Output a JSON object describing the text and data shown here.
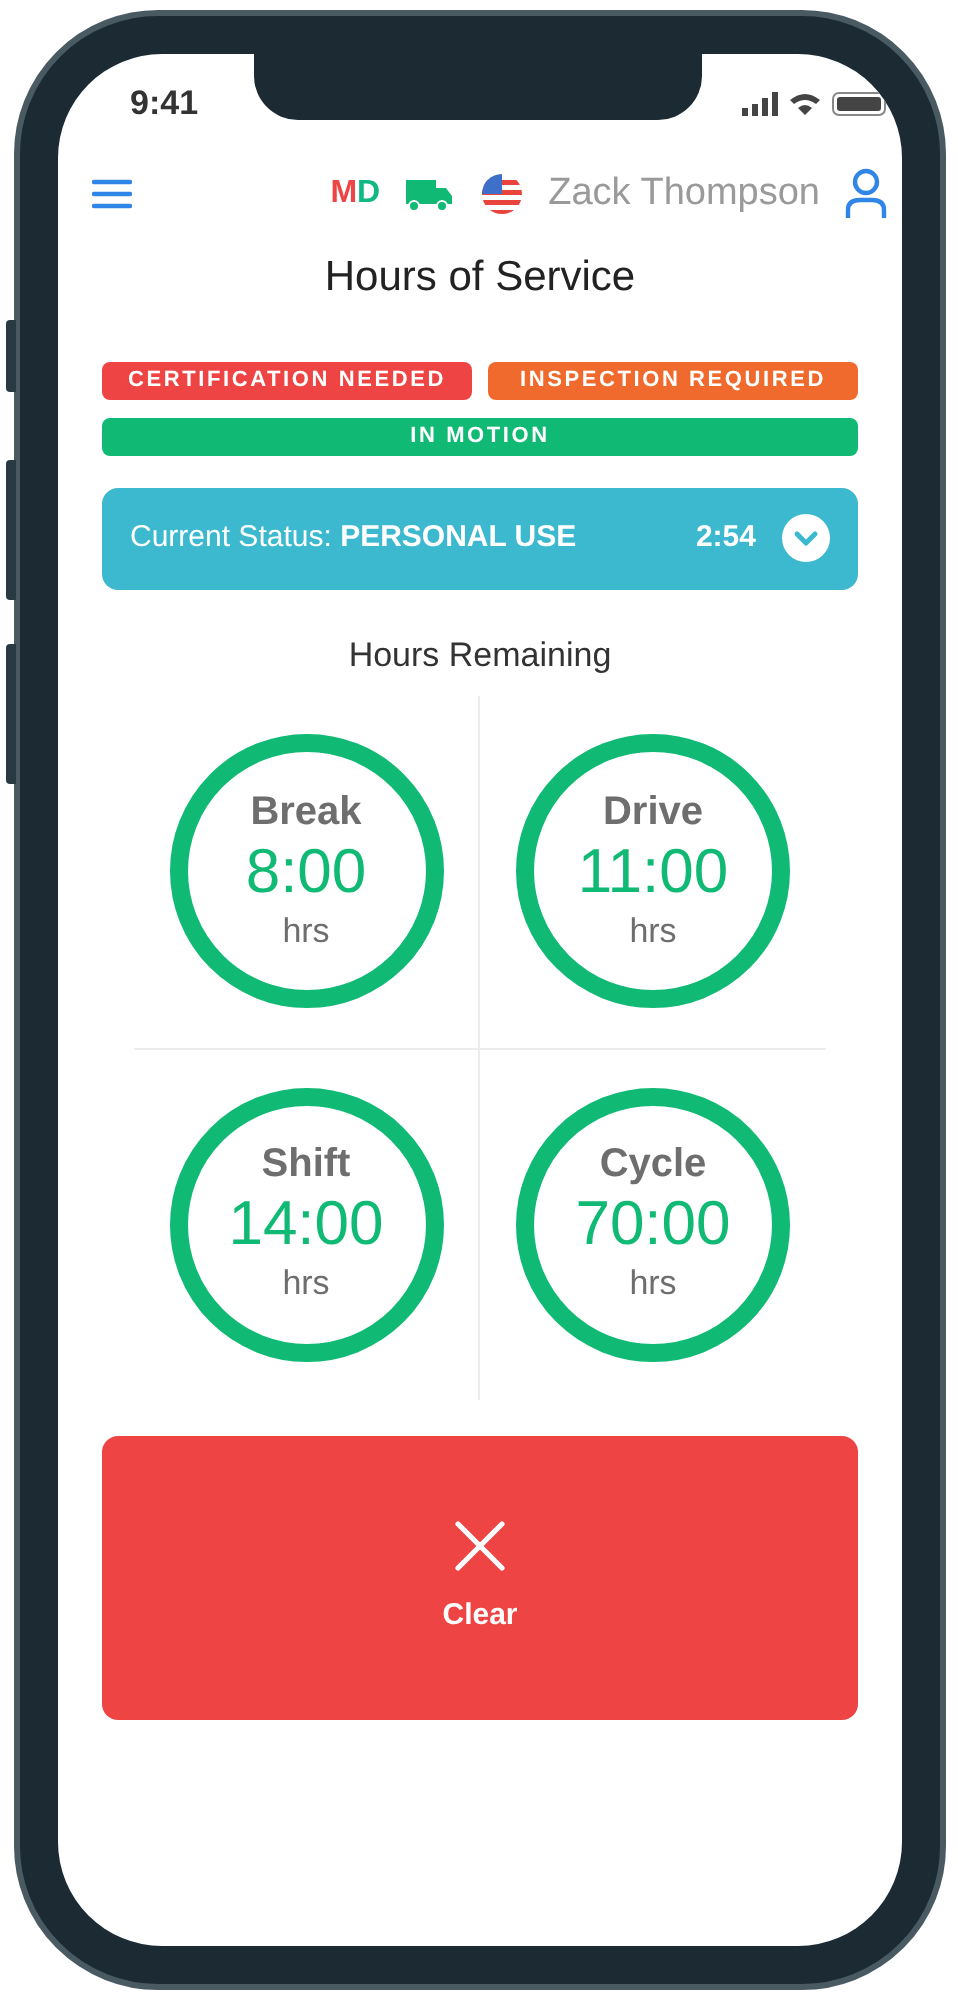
{
  "status_bar": {
    "time": "9:41"
  },
  "header": {
    "duty_letters": [
      {
        "text": "M",
        "color": "#ef4444"
      },
      {
        "text": "D",
        "color": "#10b981"
      }
    ],
    "user_name": "Zack Thompson"
  },
  "title": "Hours of Service",
  "alerts": [
    {
      "label": "CERTIFICATION NEEDED",
      "color": "#ef4444",
      "wide": false
    },
    {
      "label": "INSPECTION REQUIRED",
      "color": "#f06a2d",
      "wide": false
    },
    {
      "label": "IN MOTION",
      "color": "#10b974",
      "wide": true
    }
  ],
  "current_status": {
    "prefix": "Current Status:",
    "value": "PERSONAL USE",
    "time": "2:54"
  },
  "hours_remaining": {
    "heading": "Hours Remaining",
    "clocks": [
      {
        "label": "Break",
        "value": "8:00",
        "unit": "hrs"
      },
      {
        "label": "Drive",
        "value": "11:00",
        "unit": "hrs"
      },
      {
        "label": "Shift",
        "value": "14:00",
        "unit": "hrs"
      },
      {
        "label": "Cycle",
        "value": "70:00",
        "unit": "hrs"
      }
    ]
  },
  "action": {
    "label": "Clear"
  }
}
